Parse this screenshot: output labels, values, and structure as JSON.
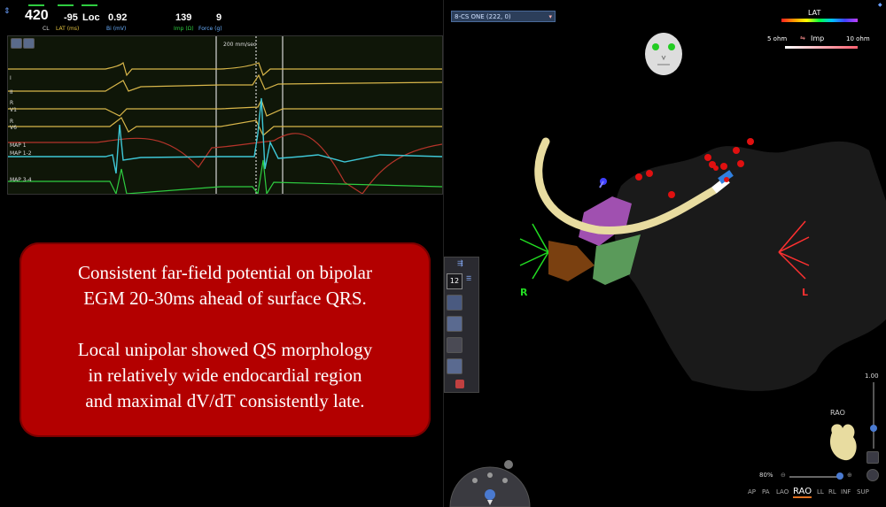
{
  "status": {
    "cl_value": "420",
    "cl_label": "CL",
    "lat_value": "-95",
    "lat_label": "LAT (ms)",
    "loc_value": "Loc",
    "bi_value": "0.92",
    "bi_label": "Bi (mV)",
    "imp_value": "139",
    "imp_label": "Imp (Ω)",
    "force_value": "9",
    "force_label": "Force (g)"
  },
  "egm": {
    "sweep_label": "200 mm/sec",
    "channels": [
      "I",
      "II",
      "R",
      "V1",
      "R",
      "V6",
      "MAP 1",
      "MAP 1-2",
      "MAP 3-4"
    ]
  },
  "annotation": {
    "para1_line1": "Consistent far-field potential on bipolar",
    "para1_line2": "EGM 20-30ms ahead of surface QRS.",
    "para2_line1": "Local unipolar showed QS morphology",
    "para2_line2": "in relatively wide endocardial region",
    "para2_line3": "and maximal dV/dT consistently late."
  },
  "map": {
    "map_selector": "8-CS ONE (222, 0)",
    "lat_legend": "LAT",
    "imp_min": "5 ohm",
    "imp_label": "Imp",
    "imp_max": "10 ohm",
    "orient_right": "R",
    "orient_left": "L",
    "toolbar_count": "12",
    "zoom_top": "1.00",
    "zoom_pct": "80%",
    "view_name": "RAO",
    "views": [
      "AP",
      "PA",
      "LAO",
      "RAO",
      "LL",
      "RL",
      "INF",
      "SUP"
    ],
    "active_view": "RAO"
  },
  "colors": {
    "annot_bg": "#b30000",
    "accent_green": "#2ecc40",
    "egm_yellow": "#d8b64a",
    "egm_cyan": "#3ec7d6",
    "egm_red": "#b5342a"
  }
}
